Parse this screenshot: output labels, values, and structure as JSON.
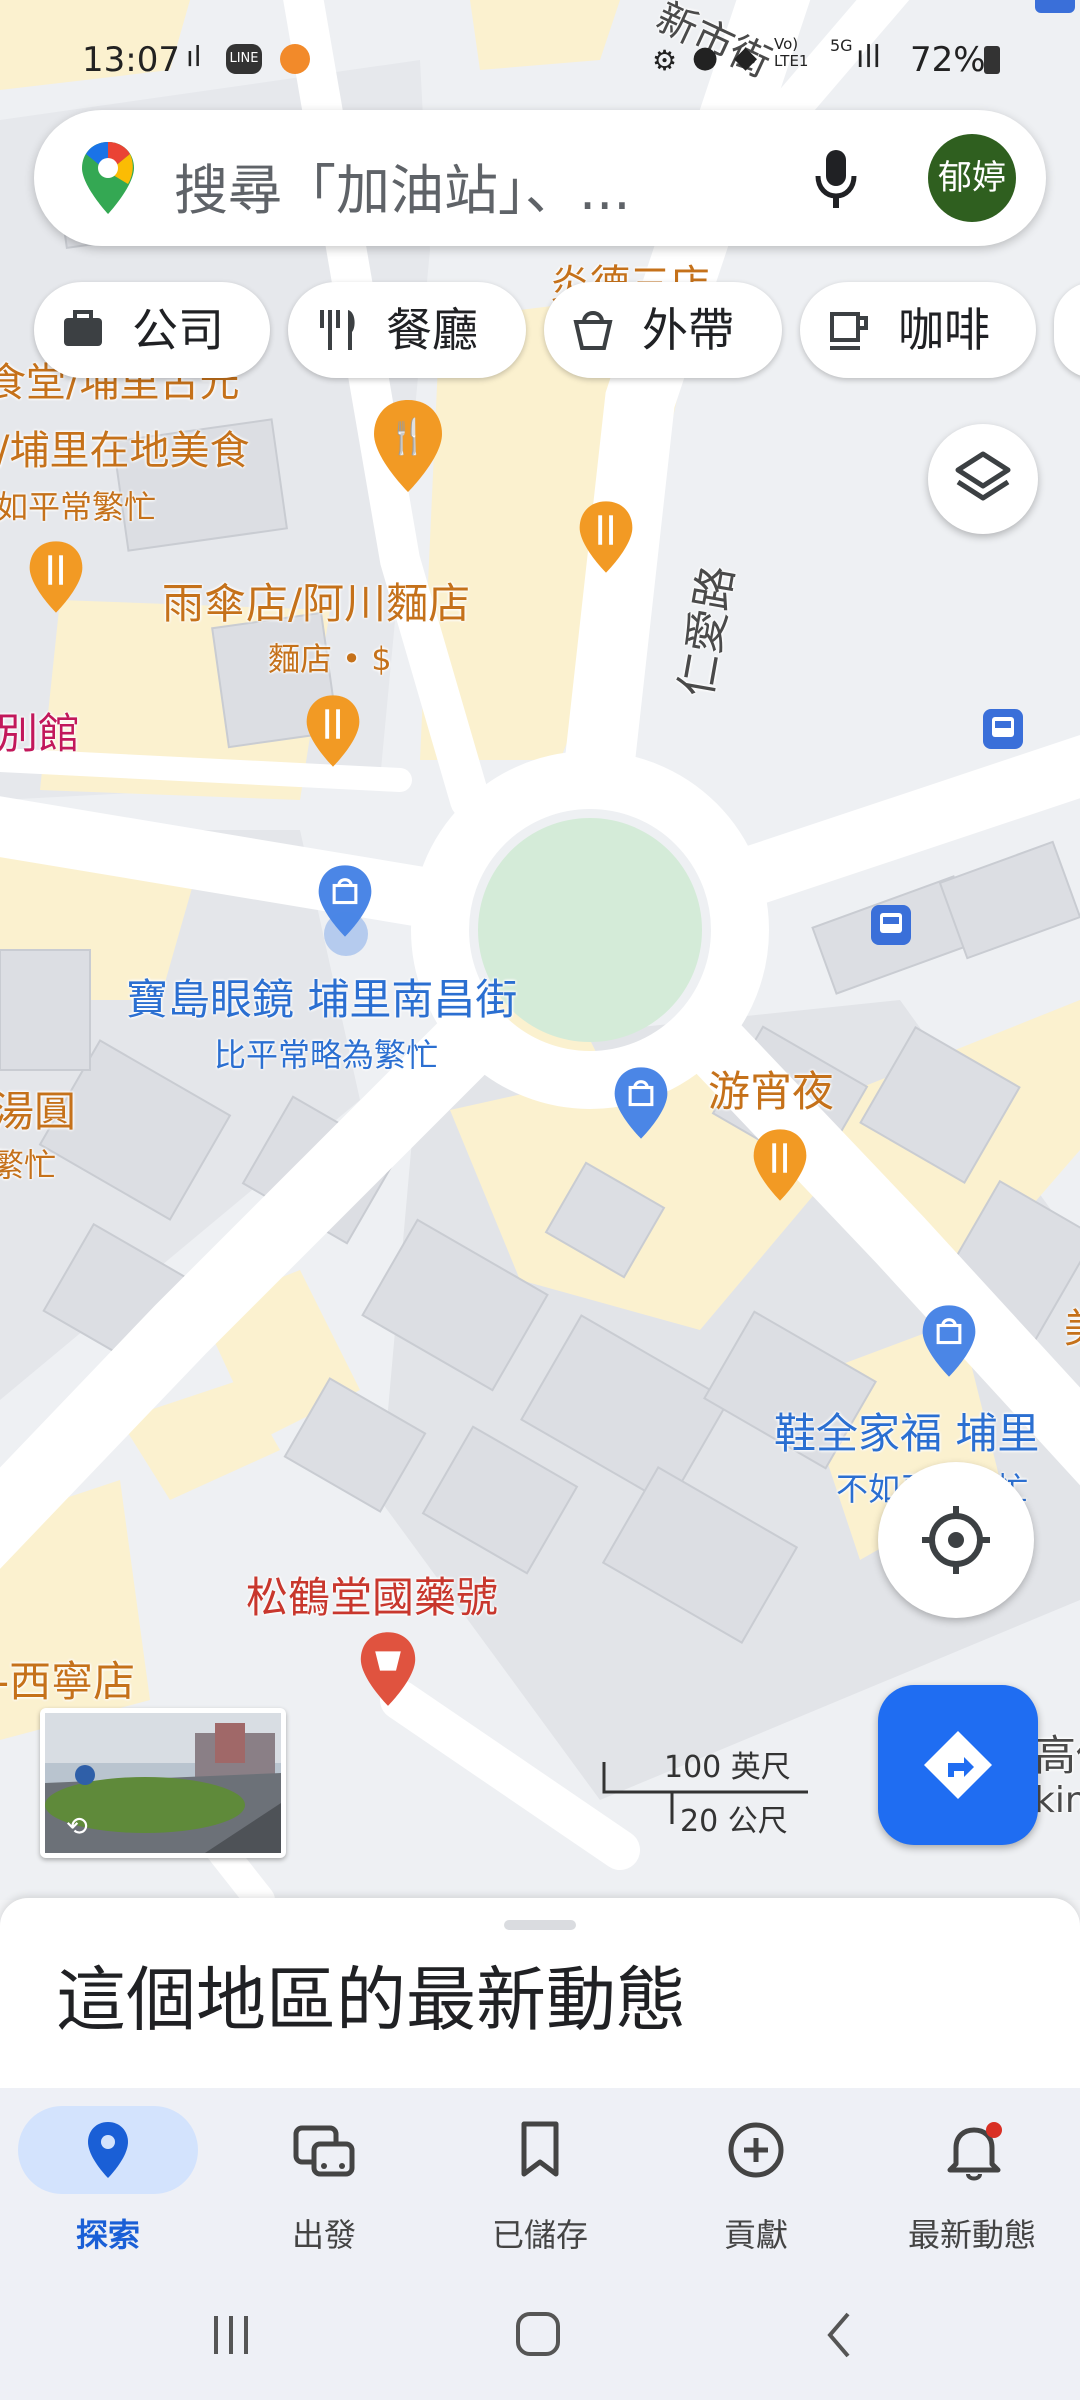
{
  "status_bar": {
    "time": "13:07",
    "battery": "72%",
    "network_label": "Vo) LTE1",
    "network_5g": "5G"
  },
  "search": {
    "placeholder": "搜尋「加油站」、...",
    "avatar_text": "郁婷"
  },
  "chips": [
    {
      "label": "公司",
      "icon": "briefcase-icon"
    },
    {
      "label": "餐廳",
      "icon": "restaurant-icon"
    },
    {
      "label": "外帶",
      "icon": "takeout-icon"
    },
    {
      "label": "咖啡",
      "icon": "coffee-icon"
    }
  ],
  "map": {
    "streets": {
      "renai": "仁愛路",
      "xinshi": "新市街"
    },
    "labels": {
      "top_partial": "炎德三店",
      "food_shitang": "食堂/埔里古元",
      "food_local": "/埔里在地美食",
      "food_busy1": "如平常繁忙",
      "umbrella": "雨傘店/阿川麵店",
      "umbrella_sub": "麵店 • $",
      "bieguan": "別館",
      "glasses": "寶島眼鏡 埔里南昌街",
      "glasses_sub": "比平常略為繁忙",
      "yuan": "湯圓",
      "yuan_sub": "繁忙",
      "youxiaoye": "游宵夜",
      "shoes": "鞋全家福 埔里",
      "shoes_sub": "不如平常繁忙",
      "pharmacy": "松鶴堂國藥號",
      "xining": "-西寧店",
      "right_partial1": "高俱",
      "right_partial2": "king",
      "right_partial3": "美"
    },
    "scale": {
      "feet": "100 英尺",
      "meters": "20 公尺"
    }
  },
  "sheet": {
    "title": "這個地區的最新動態"
  },
  "nav": [
    {
      "label": "探索",
      "icon": "explore-pin-icon",
      "active": true
    },
    {
      "label": "出發",
      "icon": "commute-icon",
      "active": false
    },
    {
      "label": "已儲存",
      "icon": "bookmark-icon",
      "active": false
    },
    {
      "label": "貢獻",
      "icon": "add-circle-icon",
      "active": false
    },
    {
      "label": "最新動態",
      "icon": "bell-icon",
      "active": false
    }
  ],
  "colors": {
    "accent": "#1f6df2",
    "food_pin": "#f29a24",
    "shop_pin": "#4b86e6",
    "pharmacy_pin": "#e0533f",
    "nav_active_bg": "#d3e3fd",
    "nav_active_text": "#1a5fd6"
  }
}
